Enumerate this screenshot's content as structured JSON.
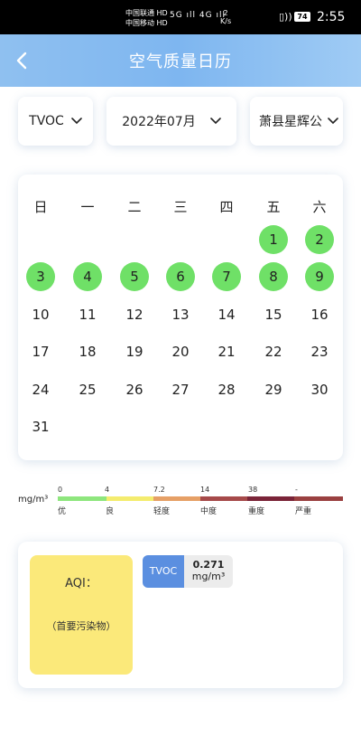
{
  "status_bar": {
    "carrier1": "中国联通 HD",
    "carrier2": "中国移动 HD",
    "signal": "5G ıll 4G ıll",
    "speed_value": "2",
    "speed_unit": "K/s",
    "vibrate": "▯))",
    "battery": "74",
    "time": "2:55"
  },
  "header": {
    "title": "空气质量日历"
  },
  "selectors": {
    "pollutant": "TVOC",
    "month": "2022年07月",
    "station": "萧县星辉公"
  },
  "calendar": {
    "weekdays": [
      "日",
      "一",
      "二",
      "三",
      "四",
      "五",
      "六"
    ],
    "rows": [
      [
        "",
        "",
        "",
        "",
        "",
        "1",
        "2"
      ],
      [
        "3",
        "4",
        "5",
        "6",
        "7",
        "8",
        "9"
      ],
      [
        "10",
        "11",
        "12",
        "13",
        "14",
        "15",
        "16"
      ],
      [
        "17",
        "18",
        "19",
        "20",
        "21",
        "22",
        "23"
      ],
      [
        "24",
        "25",
        "26",
        "27",
        "28",
        "29",
        "30"
      ],
      [
        "31",
        "",
        "",
        "",
        "",
        "",
        ""
      ]
    ],
    "highlighted_days": [
      "1",
      "2",
      "3",
      "4",
      "5",
      "6",
      "7",
      "8",
      "9"
    ],
    "highlight_color": "#6fe067"
  },
  "legend": {
    "unit": "mg/m³",
    "ticks": [
      "0",
      "4",
      "7.2",
      "14",
      "38",
      "-"
    ],
    "levels": [
      "优",
      "良",
      "轻度",
      "中度",
      "重度",
      "严重"
    ],
    "colors": [
      "#8ee67d",
      "#f4ec6e",
      "#e6a066",
      "#a64a4a",
      "#7a2438",
      "#9a4040"
    ]
  },
  "aqi": {
    "label": "AQI：",
    "primary_pollutant": "（首要污染物）",
    "box_color": "#fbe97a",
    "pollutant": {
      "name": "TVOC",
      "value": "0.271",
      "unit": "mg/m³"
    }
  }
}
